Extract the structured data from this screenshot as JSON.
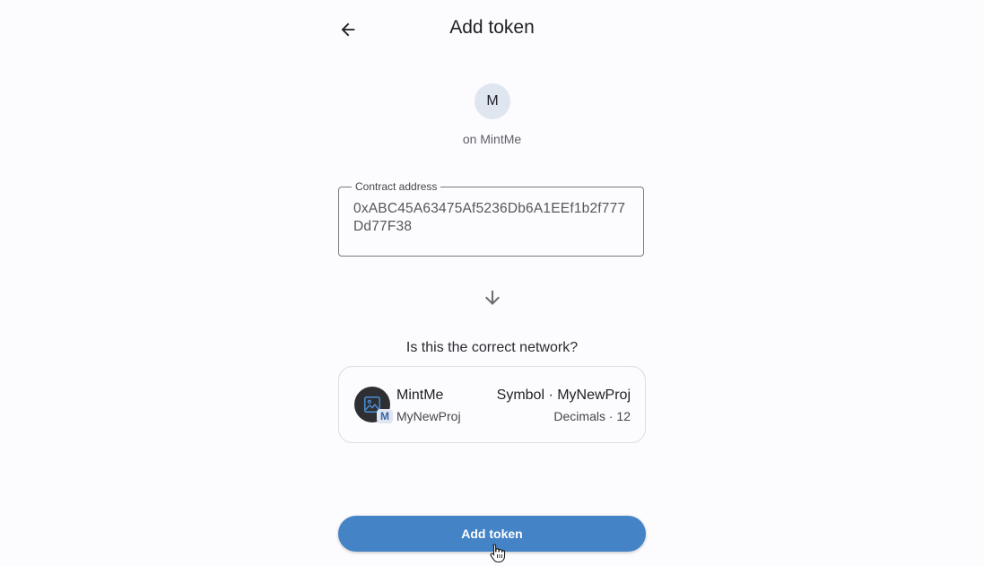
{
  "header": {
    "title": "Add token",
    "back_icon": "arrow-left-icon"
  },
  "network": {
    "avatar_letter": "M",
    "caption": "on MintMe"
  },
  "contract_field": {
    "label": "Contract address",
    "value": "0xABC45A63475Af5236Db6A1EEf1b2f777Dd77F38"
  },
  "divider_icon": "arrow-down-icon",
  "confirm": {
    "question": "Is this the correct network?"
  },
  "token": {
    "name": "MintMe",
    "subtitle": "MyNewProj",
    "symbol_text": "Symbol · MyNewProj",
    "decimals_text": "Decimals · 12",
    "badge_letter": "M",
    "avatar_icon": "image-placeholder-icon"
  },
  "actions": {
    "add_label": "Add token"
  },
  "colors": {
    "primary": "#4383c6",
    "background": "#fcfbfe",
    "avatar_bg": "#dfe6f0",
    "token_avatar_bg": "#2d2f33"
  }
}
